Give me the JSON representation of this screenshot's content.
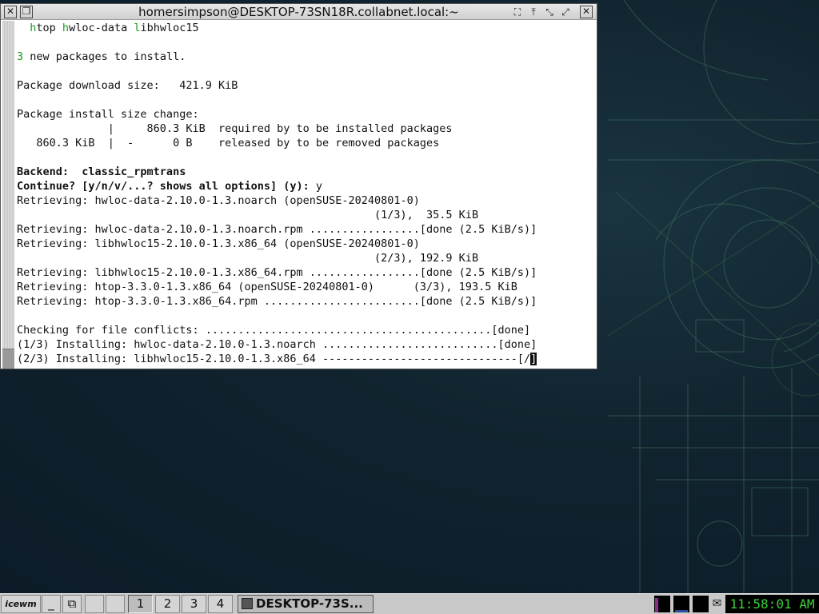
{
  "window": {
    "title": "homersimpson@DESKTOP-73SN18R.collabnet.local:~",
    "left_icons": [
      "close-x-icon",
      "restore-icon"
    ],
    "right_icons": [
      "fullscreen-icon",
      "raise-icon",
      "minimize-icon",
      "maximize-icon",
      "close-icon"
    ]
  },
  "terminal": {
    "lines": [
      {
        "pre": "  ",
        "hl": "h",
        "text": "top ",
        "hl2": "h",
        "text2": "wloc-data ",
        "hl3": "l",
        "text3": "ibhwloc15"
      },
      {
        "text": ""
      },
      {
        "hl": "3",
        "text": " new packages to install."
      },
      {
        "text": ""
      },
      {
        "text": "Package download size:   421.9 KiB"
      },
      {
        "text": ""
      },
      {
        "text": "Package install size change:"
      },
      {
        "text": "              |     860.3 KiB  required by to be installed packages"
      },
      {
        "text": "   860.3 KiB  |  -      0 B    released by to be removed packages"
      },
      {
        "text": ""
      },
      {
        "bold": true,
        "text": "Backend:  classic_rpmtrans"
      },
      {
        "bold": true,
        "text": "Continue? [y/n/v/...? shows all options] (y): ",
        "plain": "y"
      },
      {
        "text": "Retrieving: hwloc-data-2.10.0-1.3.noarch (openSUSE-20240801-0)"
      },
      {
        "text": "                                                       (1/3),  35.5 KiB"
      },
      {
        "text": "Retrieving: hwloc-data-2.10.0-1.3.noarch.rpm .................[done (2.5 KiB/s)]"
      },
      {
        "text": "Retrieving: libhwloc15-2.10.0-1.3.x86_64 (openSUSE-20240801-0)"
      },
      {
        "text": "                                                       (2/3), 192.9 KiB"
      },
      {
        "text": "Retrieving: libhwloc15-2.10.0-1.3.x86_64.rpm .................[done (2.5 KiB/s)]"
      },
      {
        "text": "Retrieving: htop-3.3.0-1.3.x86_64 (openSUSE-20240801-0)      (3/3), 193.5 KiB"
      },
      {
        "text": "Retrieving: htop-3.3.0-1.3.x86_64.rpm ........................[done (2.5 KiB/s)]"
      },
      {
        "text": ""
      },
      {
        "text": "Checking for file conflicts: ............................................[done]"
      },
      {
        "text": "(1/3) Installing: hwloc-data-2.10.0-1.3.noarch ...........................[done]"
      },
      {
        "text": "(2/3) Installing: libhwloc15-2.10.0-1.3.x86_64 ------------------------------[/",
        "cursor": "]"
      }
    ]
  },
  "taskbar": {
    "start_label": "icewm",
    "minimize_label": "_",
    "workspaces": [
      "1",
      "2",
      "3",
      "4"
    ],
    "active_workspace": "1",
    "task_label": "DESKTOP-73S...",
    "clock": "11:58:01 AM",
    "colors": {
      "clock_text": "#3ad13a",
      "monitor_cpu": "#8a2c8a",
      "monitor_net": "#2c4c9a"
    }
  }
}
